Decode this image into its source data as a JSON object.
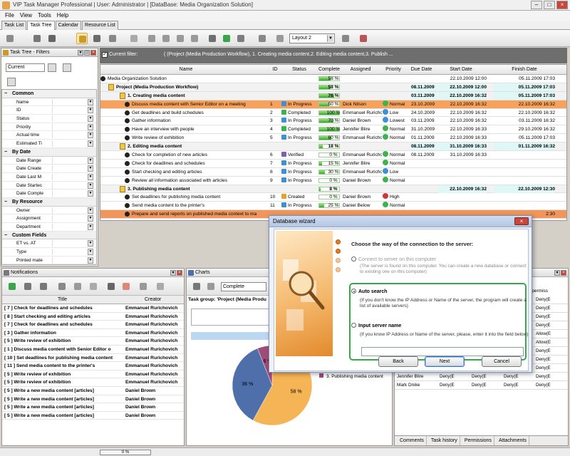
{
  "window": {
    "title": "VIP Task Manager Professional | User: Administrator | [DataBase: Media Organization Solution]"
  },
  "menu": [
    "File",
    "View",
    "Tools",
    "Help"
  ],
  "tabs": [
    "Task List",
    "Task Tree",
    "Calendar",
    "Resource List"
  ],
  "active_tab": "Task Tree",
  "toolbar": {
    "layout_value": "Layout 2"
  },
  "filters_panel": {
    "title": "Task Tree - Filters",
    "combo_value": "Current",
    "categories": [
      {
        "name": "Common",
        "items": [
          "Name",
          "ID",
          "Status",
          "Priority",
          "Actual time",
          "Estimated Ti"
        ]
      },
      {
        "name": "By Date",
        "items": [
          "Date Range",
          "Date Create",
          "Date Last M",
          "Date Startec",
          "Date Comple"
        ]
      },
      {
        "name": "By Resource",
        "items": [
          "Owner",
          "Assignment",
          "Department"
        ]
      },
      {
        "name": "Custom Fields",
        "items": [
          "ET vs. AT",
          "Type",
          "Printed mate"
        ]
      }
    ]
  },
  "filter_bar": {
    "label": "Current filter:",
    "text": "( (Project (Media Production Workflow), 1. Creating media content,2. Editing media content,3. Publish ..."
  },
  "task_tree": {
    "columns": [
      "Name",
      "ID",
      "Status",
      "Complete",
      "Assigned",
      "Priority",
      "Due Date",
      "Start Date",
      "Finish Date"
    ],
    "rows": [
      {
        "level": 0,
        "kind": "root",
        "name": "Media Organization Solution",
        "id": "",
        "status": "",
        "complete": "58 %",
        "complete_frac": 0.58,
        "assigned": "",
        "priority": "",
        "due": "",
        "start": "22.10.2009 12:00",
        "finish": "05.11.2009 17:03"
      },
      {
        "level": 0,
        "kind": "project",
        "name": "Project (Media Production Workflow)",
        "id": "",
        "status": "",
        "complete": "58 %",
        "complete_frac": 0.58,
        "assigned": "",
        "priority": "",
        "due": "08.11.2009",
        "start": "22.10.2009 12:00",
        "finish": "05.11.2009 17:03"
      },
      {
        "level": 1,
        "kind": "group",
        "name": "1. Creating media content",
        "id": "",
        "status": "",
        "complete": "76 %",
        "complete_frac": 0.76,
        "assigned": "",
        "priority": "",
        "due": "03.11.2009",
        "start": "22.10.2009 16:32",
        "finish": "05.11.2009 17:03"
      },
      {
        "level": 2,
        "kind": "task sel",
        "name": "Discuss media content with Senior Editor on a meeting",
        "id": "1",
        "status": "In Progress",
        "complete": "50 %",
        "complete_frac": 0.5,
        "assigned": "Dick Nilson",
        "priority": "Normal",
        "prio": "n",
        "due": "23.10.2009",
        "start": "22.10.2009 16:32",
        "finish": "22.10.2009 16:32"
      },
      {
        "level": 2,
        "kind": "task",
        "name": "Get deadlines and build schedules",
        "id": "2",
        "status": "Completed",
        "complete": "100 %",
        "complete_frac": 1.0,
        "assigned": "Emmanuel Rurichovich",
        "priority": "Low",
        "prio": "l",
        "due": "24.10.2009",
        "start": "22.10.2009 16:32",
        "finish": "22.10.2009 16:32"
      },
      {
        "level": 2,
        "kind": "task",
        "name": "Gather information",
        "id": "3",
        "status": "In Progress",
        "complete": "70 %",
        "complete_frac": 0.7,
        "assigned": "Daniel Brown",
        "priority": "Lowest",
        "prio": "l",
        "due": "03.11.2009",
        "start": "22.10.2009 16:32",
        "finish": "03.11.2009 16:32"
      },
      {
        "level": 2,
        "kind": "task",
        "name": "Have an interview with people",
        "id": "4",
        "status": "Completed",
        "complete": "100 %",
        "complete_frac": 1.0,
        "assigned": "Jennifer Blire",
        "priority": "Normal",
        "prio": "n",
        "due": "31.10.2009",
        "start": "22.10.2009 16:33",
        "finish": "29.10.2009 16:32"
      },
      {
        "level": 2,
        "kind": "task",
        "name": "Write review of exhibition",
        "id": "5",
        "status": "In Progress",
        "complete": "60 %",
        "complete_frac": 0.6,
        "assigned": "Emmanuel Rurichovich",
        "priority": "Normal",
        "prio": "n",
        "due": "01.11.2009",
        "start": "22.10.2009 16:33",
        "finish": "05.11.2009 17:03"
      },
      {
        "level": 1,
        "kind": "group",
        "name": "2. Editing media content",
        "id": "",
        "status": "",
        "complete": "18 %",
        "complete_frac": 0.18,
        "assigned": "",
        "priority": "",
        "due": "08.11.2009",
        "start": "31.10.2009 16:33",
        "finish": "01.11.2009 16:32"
      },
      {
        "level": 2,
        "kind": "task",
        "name": "Check for completion of new articles",
        "id": "6",
        "status": "Verified",
        "complete": "0 %",
        "complete_frac": 0.0,
        "assigned": "Emmanuel Rurichovich",
        "priority": "Normal",
        "prio": "n",
        "due": "08.11.2009",
        "start": "31.10.2009 16:33",
        "finish": ""
      },
      {
        "level": 2,
        "kind": "task",
        "name": "Check for deadlines and schedules",
        "id": "7",
        "status": "In Progress",
        "complete": "15 %",
        "complete_frac": 0.15,
        "assigned": "Jennifer Blire",
        "priority": "Normal",
        "prio": "n",
        "due": "",
        "start": "",
        "finish": ""
      },
      {
        "level": 2,
        "kind": "task",
        "name": "Start checking and editing articles",
        "id": "8",
        "status": "In Progress",
        "complete": "30 %",
        "complete_frac": 0.3,
        "assigned": "Emmanuel Rurichovich",
        "priority": "Low",
        "prio": "l",
        "due": "",
        "start": "",
        "finish": ""
      },
      {
        "level": 2,
        "kind": "task",
        "name": "Review all information associated with articles",
        "id": "9",
        "status": "In Progress",
        "complete": "0 %",
        "complete_frac": 0.0,
        "assigned": "Daniel Brown",
        "priority": "Normal",
        "prio": "n",
        "due": "",
        "start": "",
        "finish": ""
      },
      {
        "level": 1,
        "kind": "group",
        "name": "3. Publishing media content",
        "id": "",
        "status": "",
        "complete": "8 %",
        "complete_frac": 0.08,
        "assigned": "",
        "priority": "",
        "due": "",
        "start": "22.10.2009 16:32",
        "finish": "22.10.2009 12:30"
      },
      {
        "level": 2,
        "kind": "task",
        "name": "Set deadlines for publishing media content",
        "id": "10",
        "status": "Created",
        "complete": "0 %",
        "complete_frac": 0.0,
        "assigned": "Daniel Brown",
        "priority": "High",
        "prio": "h",
        "due": "",
        "start": "",
        "finish": ""
      },
      {
        "level": 2,
        "kind": "task",
        "name": "Send media content to the printer's",
        "id": "11",
        "status": "In Progress",
        "complete": "25 %",
        "complete_frac": 0.25,
        "assigned": "Daniel Below",
        "priority": "Normal",
        "prio": "n",
        "due": "",
        "start": "",
        "finish": ""
      },
      {
        "level": 2,
        "kind": "task last",
        "name": "Prepare and send reports on published media context to ma",
        "id": "",
        "status": "",
        "complete": "",
        "complete_frac": 0.0,
        "assigned": "",
        "priority": "",
        "prio": "n",
        "due": "",
        "start": "",
        "finish": "2:30"
      }
    ]
  },
  "notifications": {
    "title": "Notifications",
    "columns": [
      "Title",
      "Creator"
    ],
    "rows": [
      {
        "title": "[ 7 ] Check for deadlines and schedules",
        "creator": "Emmanuel Rurichovich"
      },
      {
        "title": "[ 8 ] Start checking and editing articles",
        "creator": "Emmanuel Rurichovich"
      },
      {
        "title": "[ 7 ] Check for deadlines and schedules",
        "creator": "Emmanuel Rurichovich"
      },
      {
        "title": "[ 3 ] Gather information",
        "creator": "Emmanuel Rurichovich"
      },
      {
        "title": "[ 5 ] Write review of exhibition",
        "creator": "Emmanuel Rurichovich"
      },
      {
        "title": "[ 1 ] Discuss media content with Senior Editor o",
        "creator": "Emmanuel Rurichovich"
      },
      {
        "title": "[ 10 ] Set deadlines for publishing media content",
        "creator": "Emmanuel Rurichovich"
      },
      {
        "title": "[ 11 ] Send media content to the printer's",
        "creator": "Emmanuel Rurichovich"
      },
      {
        "title": "[ 5 ] Write review of exhibition",
        "creator": "Emmanuel Rurichovich"
      },
      {
        "title": "[ 5 ] Write review of exhibition",
        "creator": "Emmanuel Rurichovich"
      },
      {
        "title": "[ 5 ] Write a new media content [articles]",
        "creator": "Daniel Brown"
      },
      {
        "title": "[ 5 ] Write a new media content [articles]",
        "creator": "Daniel Brown"
      },
      {
        "title": "[ 5 ] Write a new media content [articles]",
        "creator": "Daniel Brown"
      },
      {
        "title": "[ 5 ] Write a new media content [articles]",
        "creator": "Daniel Brown"
      }
    ]
  },
  "charts": {
    "title": "Charts",
    "combo_value": "Complete",
    "group_label": "Task group: 'Project (Media Produ",
    "bar_label": "Complete"
  },
  "chart_data": {
    "type": "pie",
    "categories": [
      "1. Creating media content",
      "2. Editing media content",
      "3. Publishing media content"
    ],
    "values": [
      58,
      36,
      6
    ],
    "labels": [
      "58 %",
      "36 %",
      "6 %"
    ],
    "colors": [
      "#f5b556",
      "#4f6faa",
      "#a04c78"
    ]
  },
  "permissions": {
    "header_text": "ting permiss",
    "rows": [
      {
        "name": "",
        "cols": [
          "Deny(E",
          "Deny(E",
          "Deny(E"
        ]
      },
      {
        "name": "",
        "cols": [
          "Deny(E",
          "Deny(E",
          "Deny(E"
        ]
      },
      {
        "name": "",
        "cols": [
          "Deny(E",
          "Deny(E",
          "Deny(E"
        ]
      },
      {
        "name": "",
        "cols": [
          "Deny(E",
          "Deny(E",
          "Deny(E"
        ]
      },
      {
        "name": "",
        "cols": [
          "Deny(E",
          "Deny(E",
          "Allow(E"
        ]
      },
      {
        "name": "",
        "cols": [
          "Deny(E",
          "Deny(E",
          "Allow(E"
        ]
      },
      {
        "name": "",
        "cols": [
          "Deny(E",
          "Deny(E",
          "Deny(E"
        ]
      },
      {
        "name": "Dick Nilson",
        "cols": [
          "Deny(E",
          "Deny(E",
          "Deny(E",
          "Deny(E"
        ]
      },
      {
        "name": "Emmanuel Rurich",
        "cols": [
          "Deny(E",
          "Deny(E",
          "Deny(E",
          "Deny(E"
        ]
      },
      {
        "name": "Jennifer Blire",
        "cols": [
          "Deny(E",
          "Deny(E",
          "Deny(E",
          "Deny(E"
        ]
      },
      {
        "name": "Mark Dnike",
        "cols": [
          "Deny(E",
          "Deny(E",
          "Deny(E",
          "Deny(E"
        ]
      }
    ],
    "tabs": [
      "Comments",
      "Task history",
      "Permissions",
      "Attachments"
    ]
  },
  "statusbar": {
    "progress_text": "0 %"
  },
  "wizard": {
    "title": "Database wizard",
    "heading": "Choose the way of the connection to the server:",
    "option1_label": "Connect to server on this computer",
    "option1_desc": "(The server is found on this computer. You can create a new database or connect to existing one on this computer)",
    "option2_label": "Auto search",
    "option2_desc": "(If you don't know the IP Address or Name of the server, the program will create a list of available servers)",
    "option3_label": "Input server name",
    "option3_desc": "(If you know IP Address or Name of the server, please, enter it into the field below)",
    "ip_value": "",
    "back_label": "Back",
    "next_label": "Next",
    "cancel_label": "Cancel",
    "selected_option": "Auto search"
  }
}
